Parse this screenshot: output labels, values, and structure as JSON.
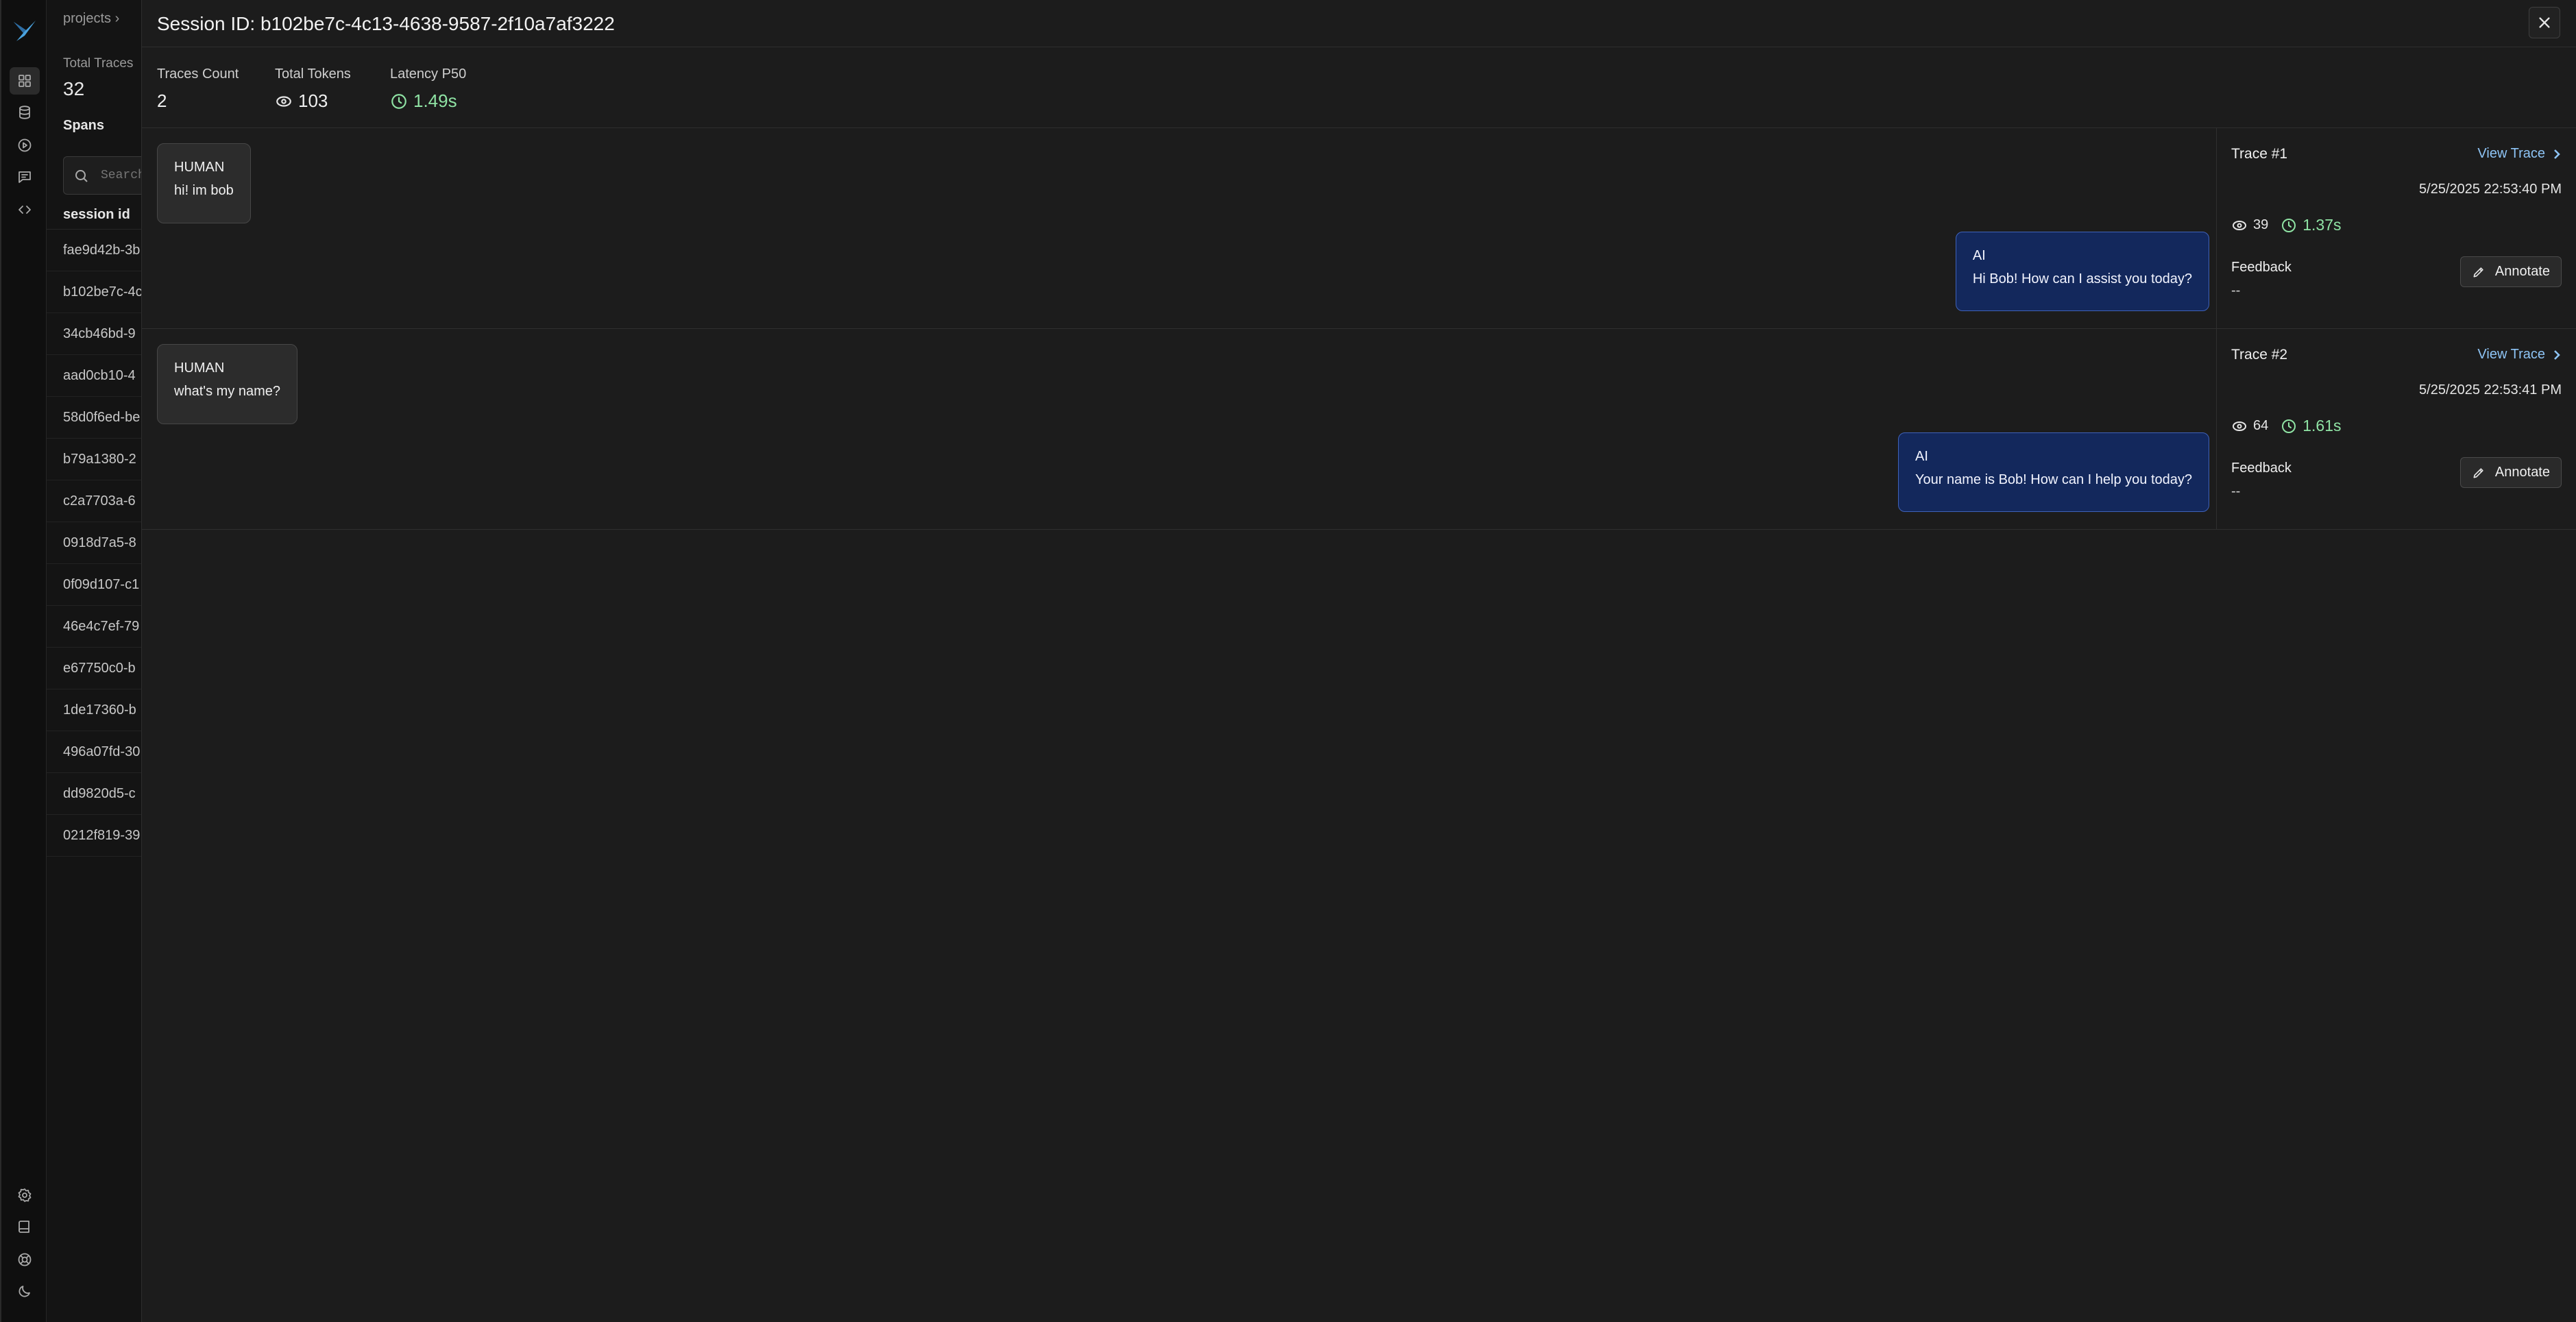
{
  "background_page": {
    "breadcrumb": "projects ›",
    "total_traces_label": "Total Traces",
    "total_traces_value": "32",
    "spans_tab": "Spans",
    "search_placeholder": "Search",
    "column_header": "session id",
    "session_rows": [
      "fae9d42b-3b",
      "b102be7c-4c",
      "34cb46bd-9",
      "aad0cb10-4",
      "58d0f6ed-be",
      "b79a1380-2",
      "c2a7703a-6",
      "0918d7a5-8",
      "0f09d107-c1",
      "46e4c7ef-79",
      "e67750c0-b",
      "1de17360-b",
      "496a07fd-30",
      "dd9820d5-c",
      "0212f819-39"
    ]
  },
  "session": {
    "title": "Session ID: b102be7c-4c13-4638-9587-2f10a7af3222",
    "stats": {
      "traces_count_label": "Traces Count",
      "traces_count_value": "2",
      "total_tokens_label": "Total Tokens",
      "total_tokens_value": "103",
      "latency_label": "Latency P50",
      "latency_value": "1.49s"
    },
    "traces": [
      {
        "label": "Trace #1",
        "view_label": "View Trace",
        "timestamp": "5/25/2025 22:53:40 PM",
        "tokens": "39",
        "latency": "1.37s",
        "feedback_label": "Feedback",
        "feedback_value": "--",
        "annotate_label": "Annotate",
        "human_role": "HUMAN",
        "human_message": "hi! im bob",
        "ai_role": "AI",
        "ai_message": "Hi Bob! How can I assist you today?"
      },
      {
        "label": "Trace #2",
        "view_label": "View Trace",
        "timestamp": "5/25/2025 22:53:41 PM",
        "tokens": "64",
        "latency": "1.61s",
        "feedback_label": "Feedback",
        "feedback_value": "--",
        "annotate_label": "Annotate",
        "human_role": "HUMAN",
        "human_message": "what's my name?",
        "ai_role": "AI",
        "ai_message": "Your name is Bob! How can I help you today?"
      }
    ]
  },
  "icons": {
    "rail_top": [
      "grid-icon",
      "database-icon",
      "play-circle-icon",
      "message-icon",
      "code-icon"
    ],
    "rail_bottom": [
      "settings-icon",
      "book-icon",
      "support-icon",
      "moon-icon"
    ]
  },
  "colors": {
    "panel_bg": "#1c1c1c",
    "human_bubble": "#2c2c2c",
    "ai_bubble": "#13285c",
    "ai_border": "#3f62b8",
    "latency_green": "#8fe3a4",
    "link_blue": "#8ec4f5"
  }
}
